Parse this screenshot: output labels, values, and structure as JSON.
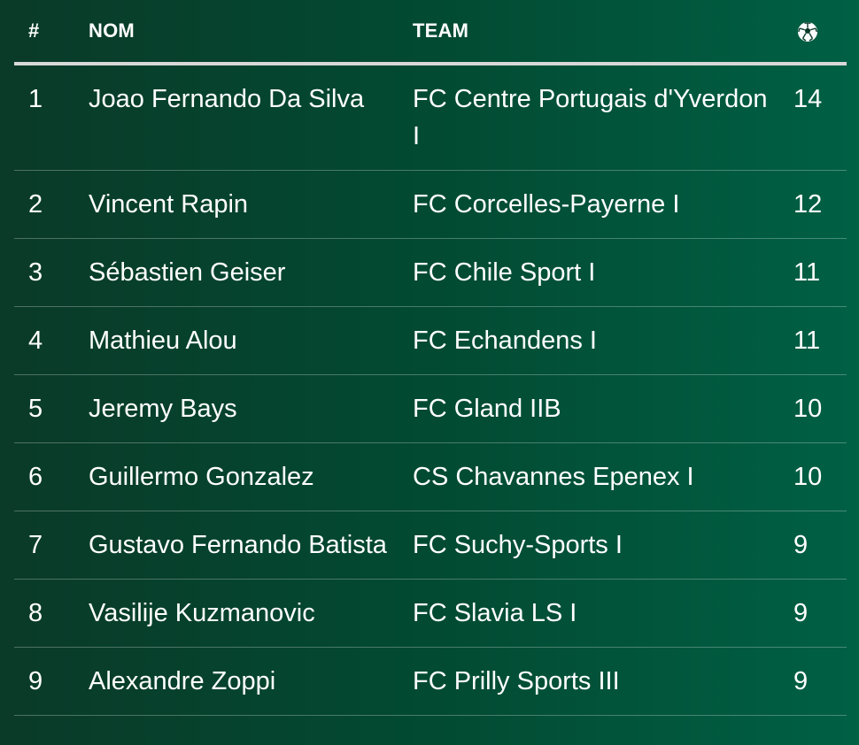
{
  "header": {
    "rank": "#",
    "name": "NOM",
    "team": "TEAM",
    "goals_icon": "soccer-ball-icon"
  },
  "rows": [
    {
      "rank": "1",
      "name": "Joao Fernando Da Silva",
      "team": "FC Centre Portugais d'Yverdon I",
      "goals": "14"
    },
    {
      "rank": "2",
      "name": "Vincent Rapin",
      "team": "FC Corcelles-Payerne I",
      "goals": "12"
    },
    {
      "rank": "3",
      "name": "Sébastien Geiser",
      "team": "FC Chile Sport I",
      "goals": "11"
    },
    {
      "rank": "4",
      "name": "Mathieu Alou",
      "team": "FC Echandens I",
      "goals": "11"
    },
    {
      "rank": "5",
      "name": "Jeremy Bays",
      "team": "FC Gland IIB",
      "goals": "10"
    },
    {
      "rank": "6",
      "name": "Guillermo Gonzalez",
      "team": "CS Chavannes Epenex I",
      "goals": "10"
    },
    {
      "rank": "7",
      "name": "Gustavo Fernando Batista",
      "team": "FC Suchy-Sports I",
      "goals": "9"
    },
    {
      "rank": "8",
      "name": "Vasilije Kuzmanovic",
      "team": "FC Slavia LS I",
      "goals": "9"
    },
    {
      "rank": "9",
      "name": "Alexandre Zoppi",
      "team": "FC Prilly Sports III",
      "goals": "9"
    }
  ],
  "colors": {
    "background_left": "#0a3a28",
    "background_right": "#006044",
    "text": "#ffffff",
    "header_rule": "#d8d8d8"
  }
}
